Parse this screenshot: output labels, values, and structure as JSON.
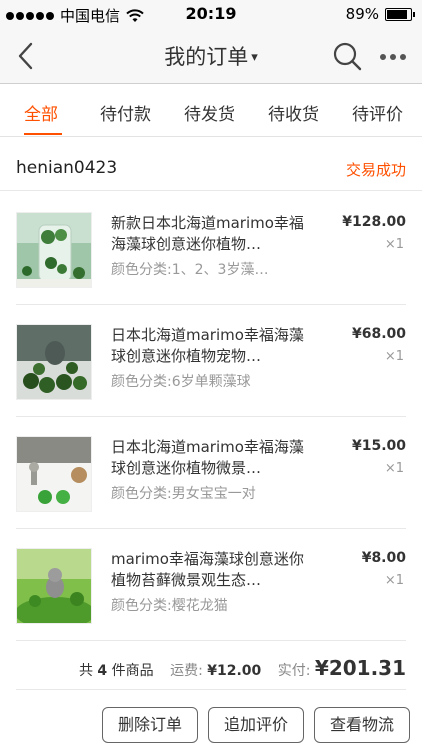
{
  "status_bar": {
    "carrier": "中国电信",
    "time": "20:19",
    "battery_percent": "89%",
    "battery_level": 0.89
  },
  "nav": {
    "title": "我的订单",
    "caret": "▾",
    "icons": [
      "back-icon",
      "search-icon",
      "more-icon"
    ]
  },
  "tabs": [
    {
      "label": "全部",
      "active": true
    },
    {
      "label": "待付款",
      "active": false
    },
    {
      "label": "待发货",
      "active": false
    },
    {
      "label": "待收货",
      "active": false
    },
    {
      "label": "待评价",
      "active": false
    }
  ],
  "order": {
    "shop_name": "henian0423",
    "status": "交易成功",
    "items": [
      {
        "title": "新款日本北海道marimo幸福海藻球创意迷你植物…",
        "sku": "颜色分类:1、2、3岁藻…",
        "price": "¥128.00",
        "qty": "×1"
      },
      {
        "title": "日本北海道marimo幸福海藻球创意迷你植物宠物…",
        "sku": "颜色分类:6岁单颗藻球",
        "price": "¥68.00",
        "qty": "×1"
      },
      {
        "title": "日本北海道marimo幸福海藻球创意迷你植物微景…",
        "sku": "颜色分类:男女宝宝一对",
        "price": "¥15.00",
        "qty": "×1"
      },
      {
        "title": "marimo幸福海藻球创意迷你植物苔藓微景观生态…",
        "sku": "颜色分类:樱花龙猫",
        "price": "¥8.00",
        "qty": "×1"
      }
    ],
    "summary": {
      "count_prefix": "共",
      "count": "4",
      "count_suffix": "件商品",
      "shipping_label": "运费:",
      "shipping_value": "¥12.00",
      "paid_label": "实付:",
      "paid_value": "¥201.31"
    },
    "actions": {
      "delete": "删除订单",
      "add_review": "追加评价",
      "logistics": "查看物流"
    }
  },
  "colors": {
    "accent": "#ff5000",
    "text": "#333333",
    "muted": "#999999"
  }
}
